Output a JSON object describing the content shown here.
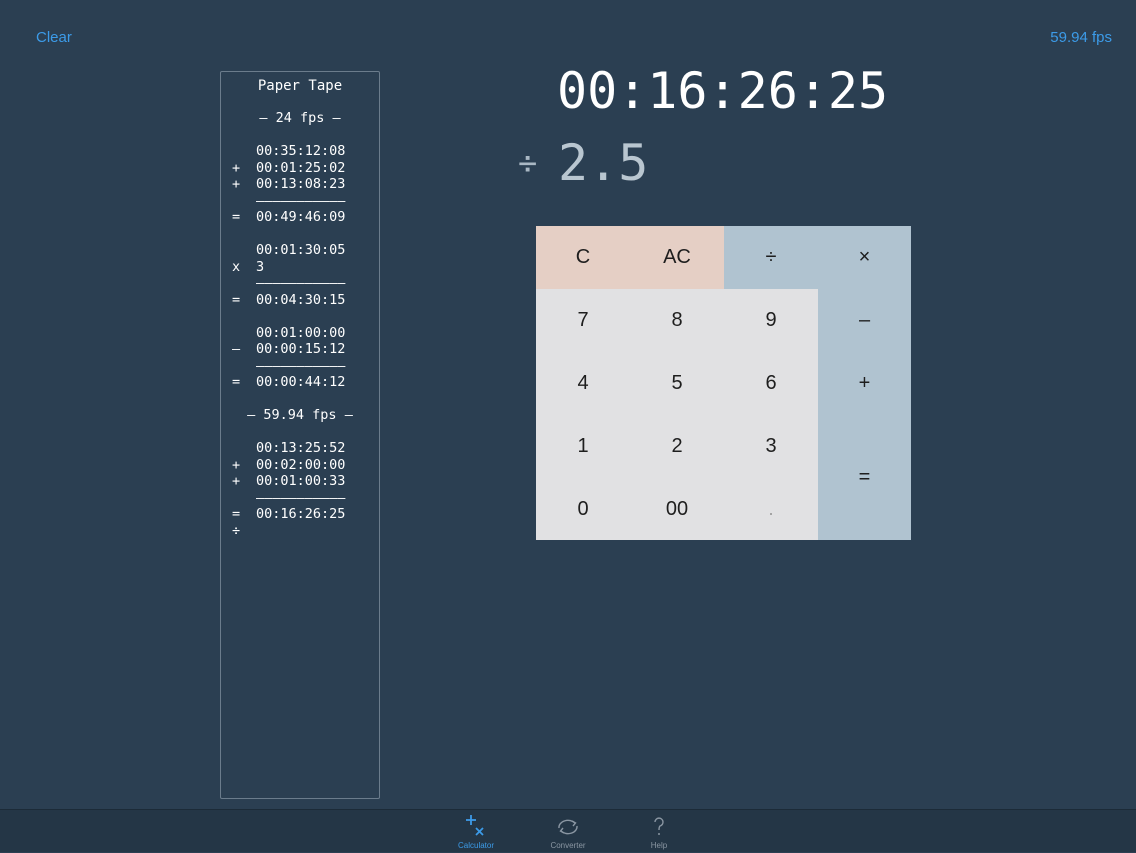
{
  "header": {
    "clear_label": "Clear",
    "fps_label": "59.94 fps"
  },
  "tape": {
    "title": "Paper Tape",
    "lines": [
      {
        "op": "",
        "val": "",
        "center": "– 24 fps –"
      },
      {
        "op": "",
        "val": "",
        "center": ""
      },
      {
        "op": "",
        "val": "00:35:12:08",
        "center": ""
      },
      {
        "op": "+",
        "val": "00:01:25:02",
        "center": ""
      },
      {
        "op": "+",
        "val": "00:13:08:23",
        "center": ""
      },
      {
        "op": "",
        "val": "———————————",
        "center": ""
      },
      {
        "op": "=",
        "val": "00:49:46:09",
        "center": ""
      },
      {
        "op": "",
        "val": "",
        "center": ""
      },
      {
        "op": "",
        "val": "00:01:30:05",
        "center": ""
      },
      {
        "op": "x",
        "val": "3",
        "center": ""
      },
      {
        "op": "",
        "val": "———————————",
        "center": ""
      },
      {
        "op": "=",
        "val": "00:04:30:15",
        "center": ""
      },
      {
        "op": "",
        "val": "",
        "center": ""
      },
      {
        "op": "",
        "val": "00:01:00:00",
        "center": ""
      },
      {
        "op": "–",
        "val": "00:00:15:12",
        "center": ""
      },
      {
        "op": "",
        "val": "———————————",
        "center": ""
      },
      {
        "op": "=",
        "val": "00:00:44:12",
        "center": ""
      },
      {
        "op": "",
        "val": "",
        "center": ""
      },
      {
        "op": "",
        "val": "",
        "center": "– 59.94 fps –"
      },
      {
        "op": "",
        "val": "",
        "center": ""
      },
      {
        "op": "",
        "val": "00:13:25:52",
        "center": ""
      },
      {
        "op": "+",
        "val": "00:02:00:00",
        "center": ""
      },
      {
        "op": "+",
        "val": "00:01:00:33",
        "center": ""
      },
      {
        "op": "",
        "val": "———————————",
        "center": ""
      },
      {
        "op": "=",
        "val": "00:16:26:25",
        "center": ""
      },
      {
        "op": "÷",
        "val": "",
        "center": ""
      }
    ]
  },
  "display": {
    "main": "00:16:26:25",
    "operator": "÷",
    "entry": "2.5"
  },
  "keypad": {
    "c": "C",
    "ac": "AC",
    "divide": "÷",
    "multiply": "×",
    "k7": "7",
    "k8": "8",
    "k9": "9",
    "minus": "–",
    "k4": "4",
    "k5": "5",
    "k6": "6",
    "plus": "+",
    "k1": "1",
    "k2": "2",
    "k3": "3",
    "equals": "=",
    "k0": "0",
    "k00": "00",
    "dot": "."
  },
  "tabs": [
    {
      "label": "Calculator",
      "icon": "plus-times-icon",
      "active": true
    },
    {
      "label": "Converter",
      "icon": "cycle-arrows-icon",
      "active": false
    },
    {
      "label": "Help",
      "icon": "question-mark-icon",
      "active": false
    }
  ],
  "colors": {
    "background": "#2b3f52",
    "accent": "#3c9be8",
    "key_light": "#e1e1e3",
    "key_clear": "#e5cfc5",
    "key_operator": "#b0c3d0"
  }
}
